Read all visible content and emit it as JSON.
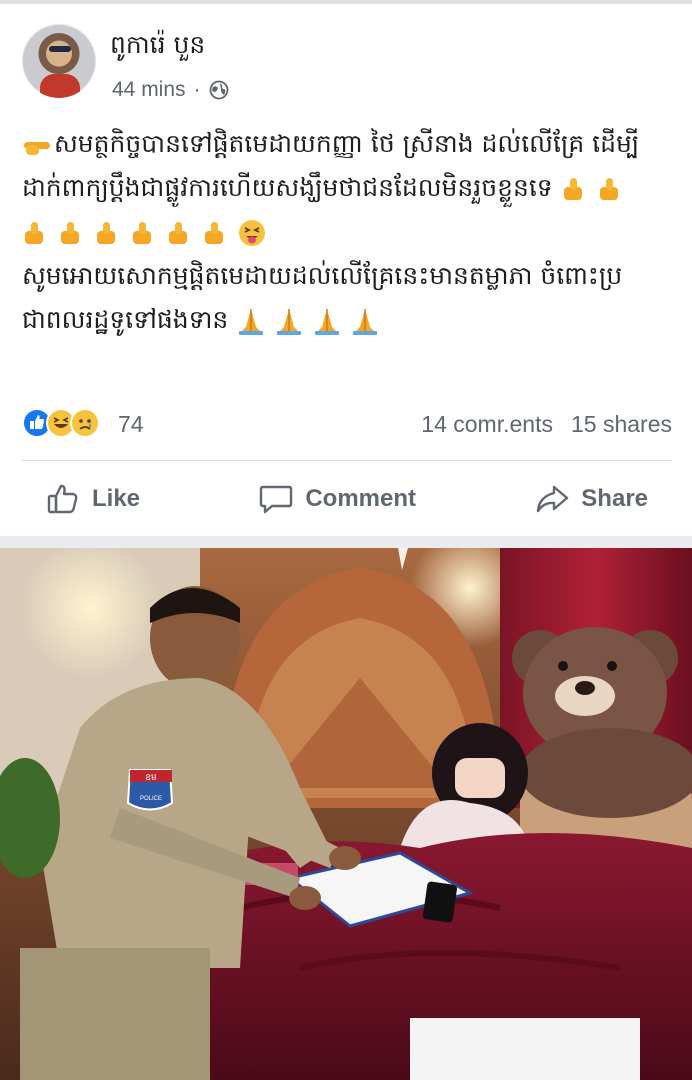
{
  "post": {
    "author": "ពូការ៉េ បួន",
    "time": "44 mins",
    "separator": "·",
    "privacy_icon": "globe-icon",
    "text_lines": [
      "សមត្ថកិច្ចបានទៅផ្ដិតមេដាយកញ្ញា ថៃ ស្រីនាង ដល់លើគ្រែ ដើម្បី",
      "ដាក់ពាក្យប្តឹងជាផ្លូវការហើយសង្ឃឹមថាជនដែលមិនរួចខ្លួនទេ",
      "សូមអោយសោកម្មផ្ដិតមេដាយដល់លើគ្រែនេះមានតម្លាភា ចំពោះប្រ",
      "ជាពលរដ្ឋទូទៅផងទាន"
    ],
    "emojis": {
      "line1_lead": "backhand-pointing-right",
      "line2_trail": [
        "thumbs-up",
        "thumbs-up"
      ],
      "line3": [
        "thumbs-up",
        "thumbs-up",
        "thumbs-up",
        "thumbs-up",
        "thumbs-up",
        "thumbs-up",
        "squinting-tongue-face"
      ],
      "line5_trail": [
        "folded-hands",
        "folded-hands",
        "folded-hands",
        "folded-hands"
      ]
    }
  },
  "stats": {
    "reactions": [
      "like",
      "haha",
      "sad"
    ],
    "reaction_count": "74",
    "comments": "14 comr.ents",
    "shares": "15 shares"
  },
  "actions": {
    "like": "Like",
    "comment": "Comment",
    "share": "Share"
  },
  "photo": {
    "badge_text": "ឧម",
    "badge_sub": "POLICE"
  },
  "colors": {
    "accent_blue": "#1877f2",
    "meta_gray": "#606770",
    "emoji_yellow": "#f5c33b"
  }
}
